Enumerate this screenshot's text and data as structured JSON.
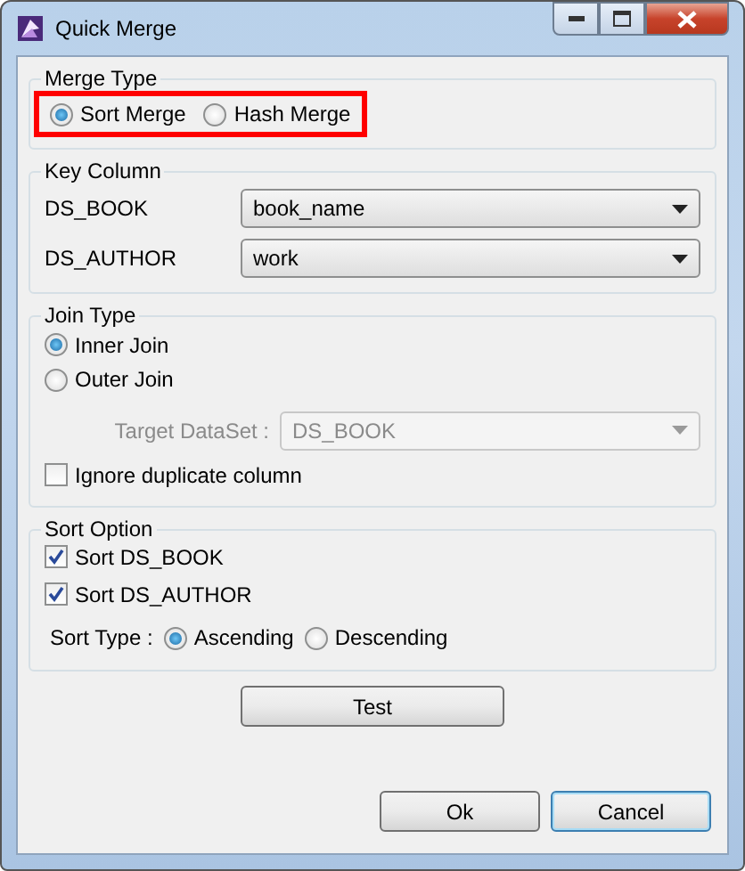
{
  "window": {
    "title": "Quick Merge"
  },
  "merge_type": {
    "title": "Merge Type",
    "highlighted": true,
    "options": [
      {
        "label": "Sort Merge",
        "selected": true
      },
      {
        "label": "Hash Merge",
        "selected": false
      }
    ]
  },
  "key_column": {
    "title": "Key Column",
    "rows": [
      {
        "label": "DS_BOOK",
        "value": "book_name"
      },
      {
        "label": "DS_AUTHOR",
        "value": "work"
      }
    ]
  },
  "join_type": {
    "title": "Join Type",
    "options": [
      {
        "label": "Inner Join",
        "selected": true
      },
      {
        "label": "Outer Join",
        "selected": false
      }
    ],
    "target": {
      "label": "Target DataSet :",
      "value": "DS_BOOK",
      "disabled": true
    },
    "ignore_duplicate": {
      "label": "Ignore duplicate column",
      "checked": false
    }
  },
  "sort_option": {
    "title": "Sort Option",
    "checks": [
      {
        "label": "Sort DS_BOOK",
        "checked": true
      },
      {
        "label": "Sort DS_AUTHOR",
        "checked": true
      }
    ],
    "sort_type": {
      "label": "Sort Type :",
      "options": [
        {
          "label": "Ascending",
          "selected": true
        },
        {
          "label": "Descending",
          "selected": false
        }
      ]
    }
  },
  "buttons": {
    "test": "Test",
    "ok": "Ok",
    "cancel": "Cancel"
  }
}
